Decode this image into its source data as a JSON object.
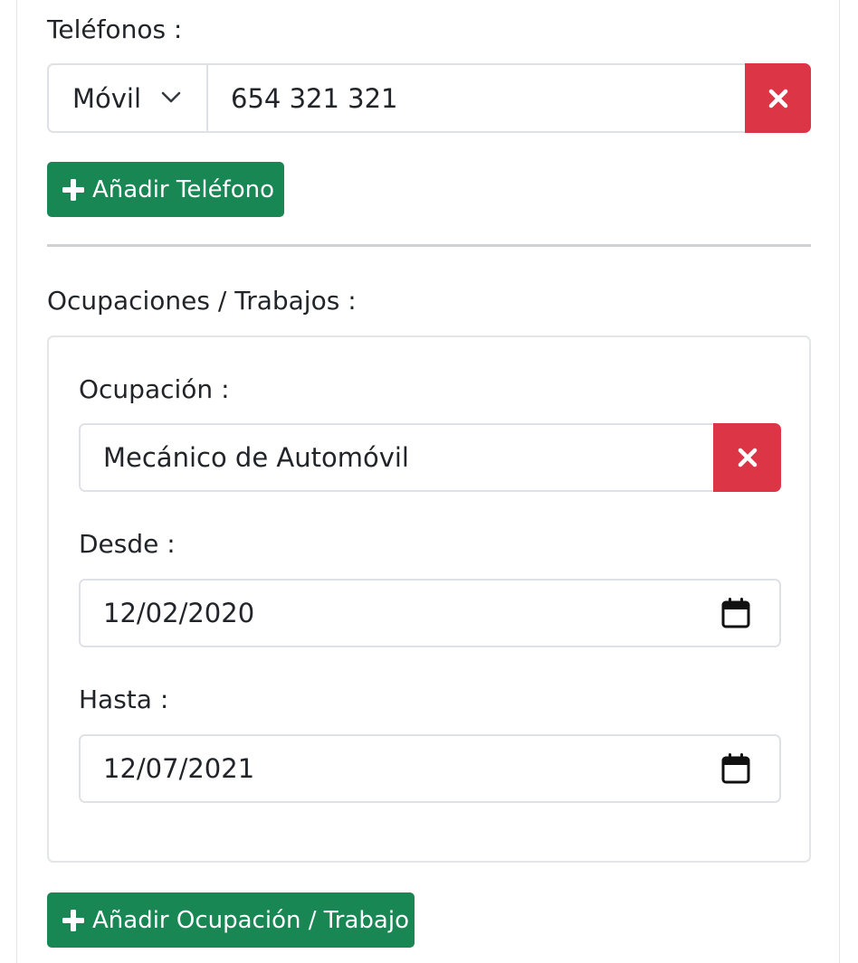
{
  "phones": {
    "label": "Teléfonos :",
    "type_select": {
      "value": "Móvil"
    },
    "number_input": {
      "value": "654 321 321"
    },
    "add_button_label": "Añadir Teléfono"
  },
  "occupations": {
    "label": "Ocupaciones / Trabajos :",
    "item": {
      "occupation_label": "Ocupación :",
      "occupation_value": "Mecánico de Automóvil",
      "from_label": "Desde :",
      "from_value": "12/02/2020",
      "to_label": "Hasta :",
      "to_value": "12/07/2021"
    },
    "add_button_label": "Añadir Ocupación / Trabajo"
  },
  "icons": {
    "remove": "close-icon",
    "add": "plus-icon",
    "select": "chevron-down-icon",
    "date": "calendar-icon"
  },
  "colors": {
    "danger": "#dc3545",
    "success": "#198754",
    "border": "#dee2e6",
    "text": "#212529"
  }
}
